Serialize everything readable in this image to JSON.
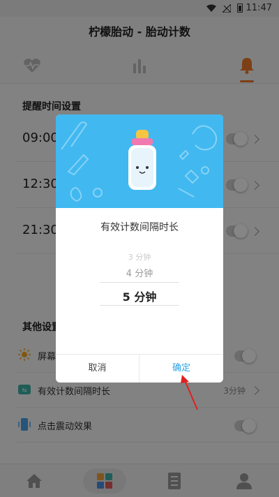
{
  "status_bar": {
    "time": "11:47"
  },
  "app": {
    "title": "柠檬胎动 - 胎动计数"
  },
  "top_tabs": [
    {
      "icon": "heartbeat-icon"
    },
    {
      "icon": "bar-chart-icon"
    },
    {
      "icon": "bell-icon",
      "active": true
    }
  ],
  "reminder": {
    "title": "提醒时间设置",
    "times": [
      "09:00",
      "12:30",
      "21:30"
    ]
  },
  "other": {
    "title": "其他设置",
    "items": [
      {
        "label": "屏幕",
        "icon": "sun-icon"
      },
      {
        "label": "有效计数间隔时长",
        "value": "3分钟",
        "icon": "interval-icon"
      },
      {
        "label": "点击震动效果",
        "icon": "vibrate-icon"
      }
    ]
  },
  "bottom_nav": [
    {
      "icon": "home-icon"
    },
    {
      "icon": "grid-icon",
      "active": true
    },
    {
      "icon": "list-icon"
    },
    {
      "icon": "user-icon"
    }
  ],
  "dialog": {
    "title": "有效计数间隔时长",
    "options": [
      "3 分钟",
      "4 分钟",
      "5 分钟"
    ],
    "selected": "5 分钟",
    "cancel_label": "取消",
    "confirm_label": "确定"
  },
  "colors": {
    "accent_orange": "#f07a2a",
    "dialog_banner": "#41b8f0",
    "confirm_blue": "#2aa4e6",
    "arrow_red": "#e02020"
  }
}
